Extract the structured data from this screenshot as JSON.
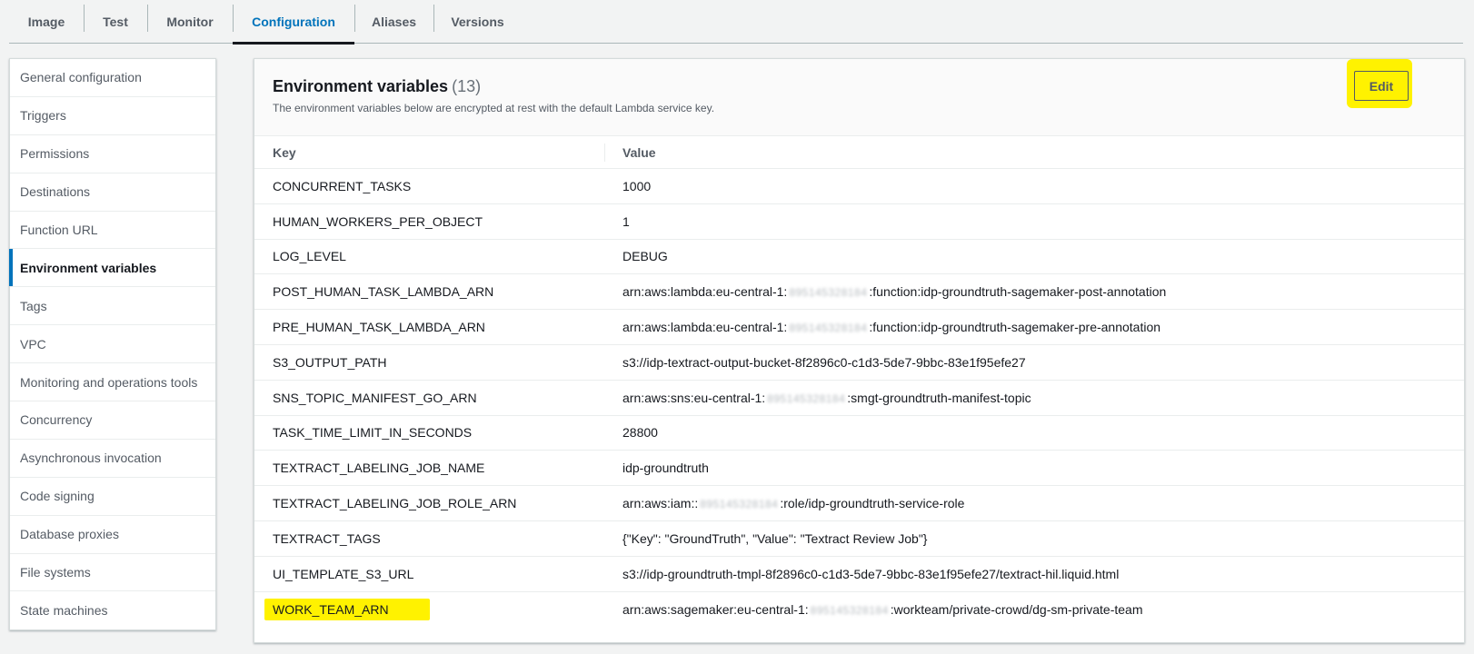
{
  "tabs": [
    {
      "label": "Image"
    },
    {
      "label": "Test"
    },
    {
      "label": "Monitor"
    },
    {
      "label": "Configuration"
    },
    {
      "label": "Aliases"
    },
    {
      "label": "Versions"
    }
  ],
  "active_tab": "Configuration",
  "sidebar": {
    "items": [
      {
        "label": "General configuration"
      },
      {
        "label": "Triggers"
      },
      {
        "label": "Permissions"
      },
      {
        "label": "Destinations"
      },
      {
        "label": "Function URL"
      },
      {
        "label": "Environment variables"
      },
      {
        "label": "Tags"
      },
      {
        "label": "VPC"
      },
      {
        "label": "Monitoring and operations tools"
      },
      {
        "label": "Concurrency"
      },
      {
        "label": "Asynchronous invocation"
      },
      {
        "label": "Code signing"
      },
      {
        "label": "Database proxies"
      },
      {
        "label": "File systems"
      },
      {
        "label": "State machines"
      }
    ],
    "active": "Environment variables"
  },
  "panel": {
    "title": "Environment variables",
    "count": "(13)",
    "description": "The environment variables below are encrypted at rest with the default Lambda service key.",
    "edit_label": "Edit"
  },
  "table": {
    "headers": {
      "key": "Key",
      "value": "Value"
    },
    "rows": [
      {
        "key": "CONCURRENT_TASKS",
        "value_pre": "1000",
        "redacted": "",
        "value_post": ""
      },
      {
        "key": "HUMAN_WORKERS_PER_OBJECT",
        "value_pre": "1",
        "redacted": "",
        "value_post": ""
      },
      {
        "key": "LOG_LEVEL",
        "value_pre": "DEBUG",
        "redacted": "",
        "value_post": ""
      },
      {
        "key": "POST_HUMAN_TASK_LAMBDA_ARN",
        "value_pre": "arn:aws:lambda:eu-central-1:",
        "redacted": "895145328184",
        "value_post": ":function:idp-groundtruth-sagemaker-post-annotation"
      },
      {
        "key": "PRE_HUMAN_TASK_LAMBDA_ARN",
        "value_pre": "arn:aws:lambda:eu-central-1:",
        "redacted": "895145328184",
        "value_post": ":function:idp-groundtruth-sagemaker-pre-annotation"
      },
      {
        "key": "S3_OUTPUT_PATH",
        "value_pre": "s3://idp-textract-output-bucket-8f2896c0-c1d3-5de7-9bbc-83e1f95efe27",
        "redacted": "",
        "value_post": ""
      },
      {
        "key": "SNS_TOPIC_MANIFEST_GO_ARN",
        "value_pre": "arn:aws:sns:eu-central-1:",
        "redacted": "895145328184",
        "value_post": ":smgt-groundtruth-manifest-topic"
      },
      {
        "key": "TASK_TIME_LIMIT_IN_SECONDS",
        "value_pre": "28800",
        "redacted": "",
        "value_post": ""
      },
      {
        "key": "TEXTRACT_LABELING_JOB_NAME",
        "value_pre": "idp-groundtruth",
        "redacted": "",
        "value_post": ""
      },
      {
        "key": "TEXTRACT_LABELING_JOB_ROLE_ARN",
        "value_pre": "arn:aws:iam::",
        "redacted": "895145328184",
        "value_post": ":role/idp-groundtruth-service-role"
      },
      {
        "key": "TEXTRACT_TAGS",
        "value_pre": "{\"Key\": \"GroundTruth\", \"Value\": \"Textract Review Job\"}",
        "redacted": "",
        "value_post": ""
      },
      {
        "key": "UI_TEMPLATE_S3_URL",
        "value_pre": "s3://idp-groundtruth-tmpl-8f2896c0-c1d3-5de7-9bbc-83e1f95efe27/textract-hil.liquid.html",
        "redacted": "",
        "value_post": ""
      },
      {
        "key": "WORK_TEAM_ARN",
        "value_pre": "arn:aws:sagemaker:eu-central-1:",
        "redacted": "895145328184",
        "value_post": ":workteam/private-crowd/dg-sm-private-team"
      }
    ]
  },
  "highlight_color": "#fff200",
  "accent_color": "#0073bb"
}
